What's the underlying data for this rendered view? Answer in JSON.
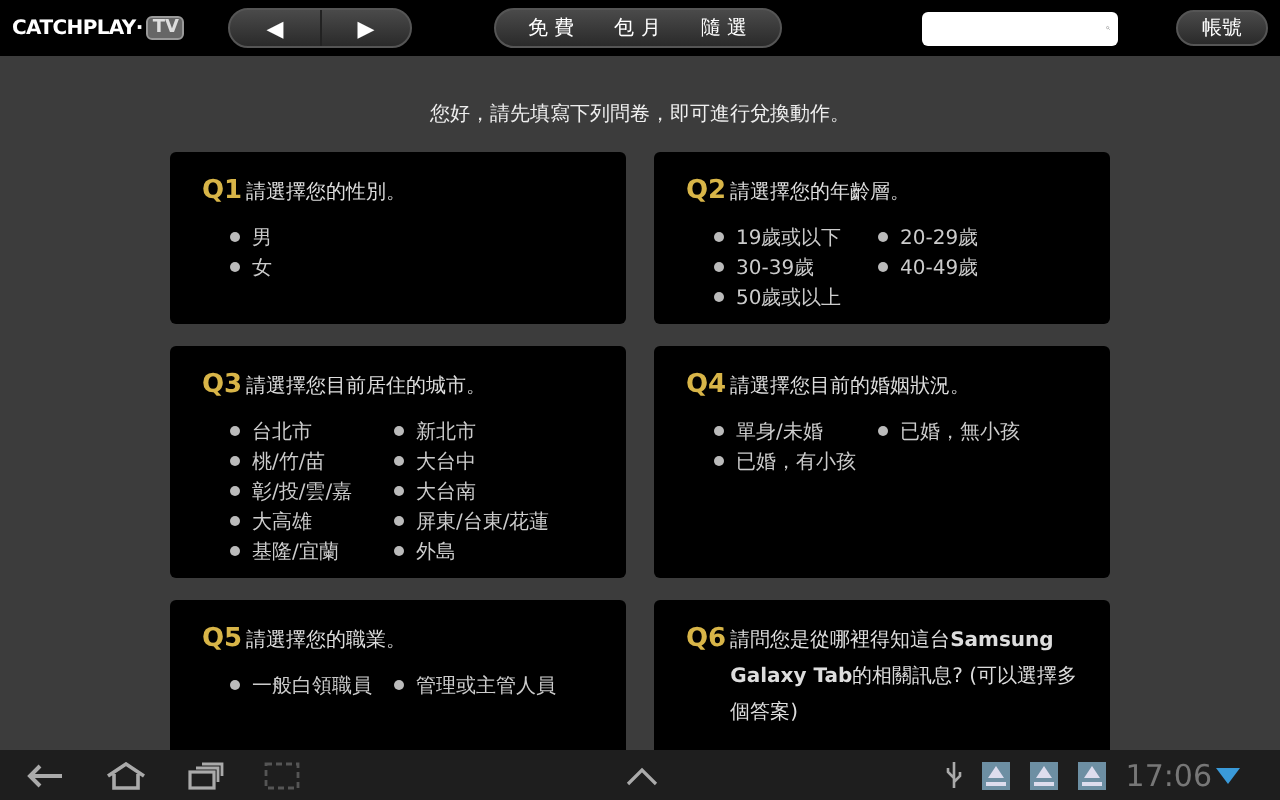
{
  "top_bar": {
    "logo": {
      "name": "CATCHPLAY·",
      "badge": "TV"
    },
    "nav_buttons": [
      "◀",
      "▶"
    ],
    "categories": [
      {
        "label": "免 費",
        "selected": false
      },
      {
        "label": "包 月",
        "selected": false
      },
      {
        "label": "隨 選",
        "selected": false
      }
    ],
    "account_button": "帳號"
  },
  "intro": "您好，請先填寫下列問卷，即可進行兌換動作。",
  "questions": [
    {
      "number": "Q1",
      "title": "請選擇您的性別。",
      "kind": "list",
      "options": [
        {
          "label": "男",
          "selected": false
        },
        {
          "label": "女",
          "selected": false
        }
      ]
    },
    {
      "number": "Q2",
      "title": "請選擇您的年齡層。",
      "kind": "grid",
      "options": [
        {
          "label": "19歲或以下",
          "selected": false
        },
        {
          "label": "20-29歲",
          "selected": false
        },
        {
          "label": "30-39歲",
          "selected": false
        },
        {
          "label": "40-49歲",
          "selected": false
        },
        {
          "label": "50歲或以上",
          "selected": false
        }
      ]
    },
    {
      "number": "Q3",
      "title": "請選擇您目前居住的城市。",
      "kind": "grid",
      "options": [
        {
          "label": "台北市",
          "selected": false
        },
        {
          "label": "新北市",
          "selected": false
        },
        {
          "label": "桃/竹/苗",
          "selected": false
        },
        {
          "label": "大台中",
          "selected": false
        },
        {
          "label": "彰/投/雲/嘉",
          "selected": false
        },
        {
          "label": "大台南",
          "selected": false
        },
        {
          "label": "大高雄",
          "selected": false
        },
        {
          "label": "屏東/台東/花蓮",
          "selected": false
        },
        {
          "label": "基隆/宜蘭",
          "selected": false
        },
        {
          "label": "外島",
          "selected": false
        }
      ]
    },
    {
      "number": "Q4",
      "title": "請選擇您目前的婚姻狀況。",
      "kind": "grid",
      "options": [
        {
          "label": "單身/未婚",
          "selected": false
        },
        {
          "label": "已婚，無小孩",
          "selected": false
        },
        {
          "label": "已婚，有小孩",
          "selected": false
        }
      ]
    },
    {
      "number": "Q5",
      "title": "請選擇您的職業。",
      "kind": "grid",
      "options": [
        {
          "label": "一般白領職員",
          "selected": false
        },
        {
          "label": "管理或主管人員",
          "selected": false
        }
      ]
    },
    {
      "number": "Q6",
      "title": "請問您是從哪裡得知這台**Samsung Galaxy Tab**的相關訊息? (可以選擇多個答案)"
    }
  ],
  "system_bar": {
    "time": "17:06"
  }
}
